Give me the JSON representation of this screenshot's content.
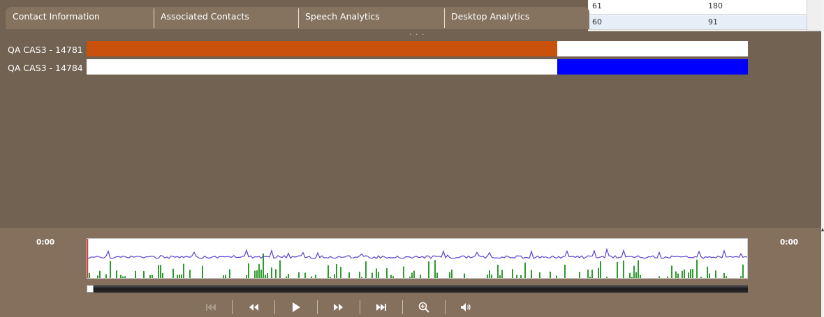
{
  "grid": {
    "row1": {
      "col1": "61",
      "col2": "180"
    },
    "row2": {
      "col1": "60",
      "col2": "91"
    }
  },
  "tabs": [
    {
      "label": "Contact Information"
    },
    {
      "label": "Associated Contacts"
    },
    {
      "label": "Speech Analytics"
    },
    {
      "label": "Desktop Analytics"
    }
  ],
  "panel": {
    "grip": "· · ·"
  },
  "tracks": [
    {
      "label": "QA CAS3 - 14781",
      "color": "#c9510c",
      "start": 0.0,
      "end": 0.712
    },
    {
      "label": "QA CAS3 - 14784",
      "color": "#0000ff",
      "start": 0.712,
      "end": 1.0
    }
  ],
  "player": {
    "time_start": "0:00",
    "time_end": "0:00",
    "position": 0.0,
    "wave_color": "#5a3fd0",
    "bar_color": "#2e9a2e",
    "playhead_color": "#e02020",
    "controls": [
      {
        "name": "skip-to-start",
        "icon": "skip-start-icon",
        "enabled": false
      },
      {
        "name": "rewind",
        "icon": "rewind-icon",
        "enabled": true
      },
      {
        "name": "play",
        "icon": "play-icon",
        "enabled": true
      },
      {
        "name": "fast-forward",
        "icon": "fast-forward-icon",
        "enabled": true
      },
      {
        "name": "skip-to-end",
        "icon": "skip-end-icon",
        "enabled": true
      },
      {
        "name": "zoom",
        "icon": "zoom-in-icon",
        "enabled": true
      },
      {
        "name": "volume",
        "icon": "volume-icon",
        "enabled": true
      }
    ]
  }
}
